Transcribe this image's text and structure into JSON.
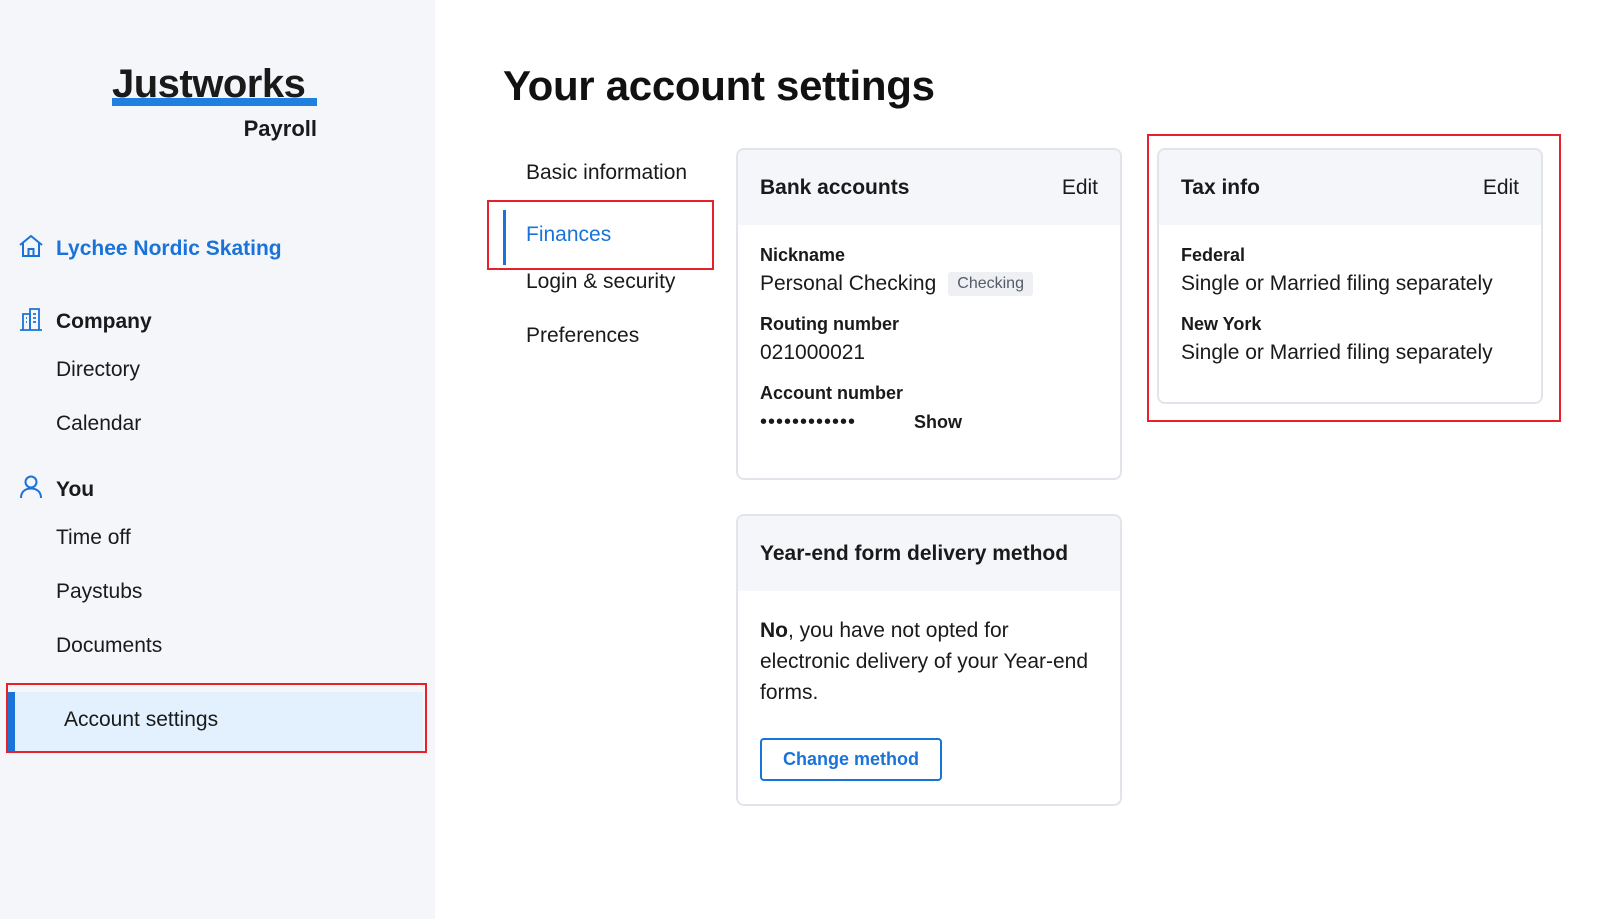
{
  "brand": {
    "name": "Justworks",
    "product": "Payroll"
  },
  "sidebar": {
    "org_label": "Lychee Nordic Skating",
    "company": {
      "label": "Company",
      "items": [
        "Directory",
        "Calendar"
      ]
    },
    "you": {
      "label": "You",
      "items": [
        "Time off",
        "Paystubs",
        "Documents",
        "Account settings"
      ]
    }
  },
  "page": {
    "title": "Your account settings",
    "subnav": [
      "Basic information",
      "Finances",
      "Login & security",
      "Preferences"
    ]
  },
  "bank_accounts": {
    "title": "Bank accounts",
    "edit_label": "Edit",
    "nickname_label": "Nickname",
    "nickname_value": "Personal Checking",
    "type_badge": "Checking",
    "routing_label": "Routing number",
    "routing_value": "021000021",
    "account_label": "Account number",
    "account_masked": "••••••••••••",
    "show_label": "Show"
  },
  "year_end": {
    "title": "Year-end form delivery method",
    "answer_bold": "No",
    "answer_text": ", you have not opted for electronic delivery of your Year-end forms.",
    "button_label": "Change method"
  },
  "tax_info": {
    "title": "Tax info",
    "edit_label": "Edit",
    "federal_label": "Federal",
    "federal_value": "Single or Married filing separately",
    "state_label": "New York",
    "state_value": "Single or Married filing separately"
  },
  "colors": {
    "accent": "#1a73d9",
    "highlight": "#e8202a",
    "sidebar_bg": "#f4f6fa",
    "active_bg": "#e3f0fd"
  }
}
